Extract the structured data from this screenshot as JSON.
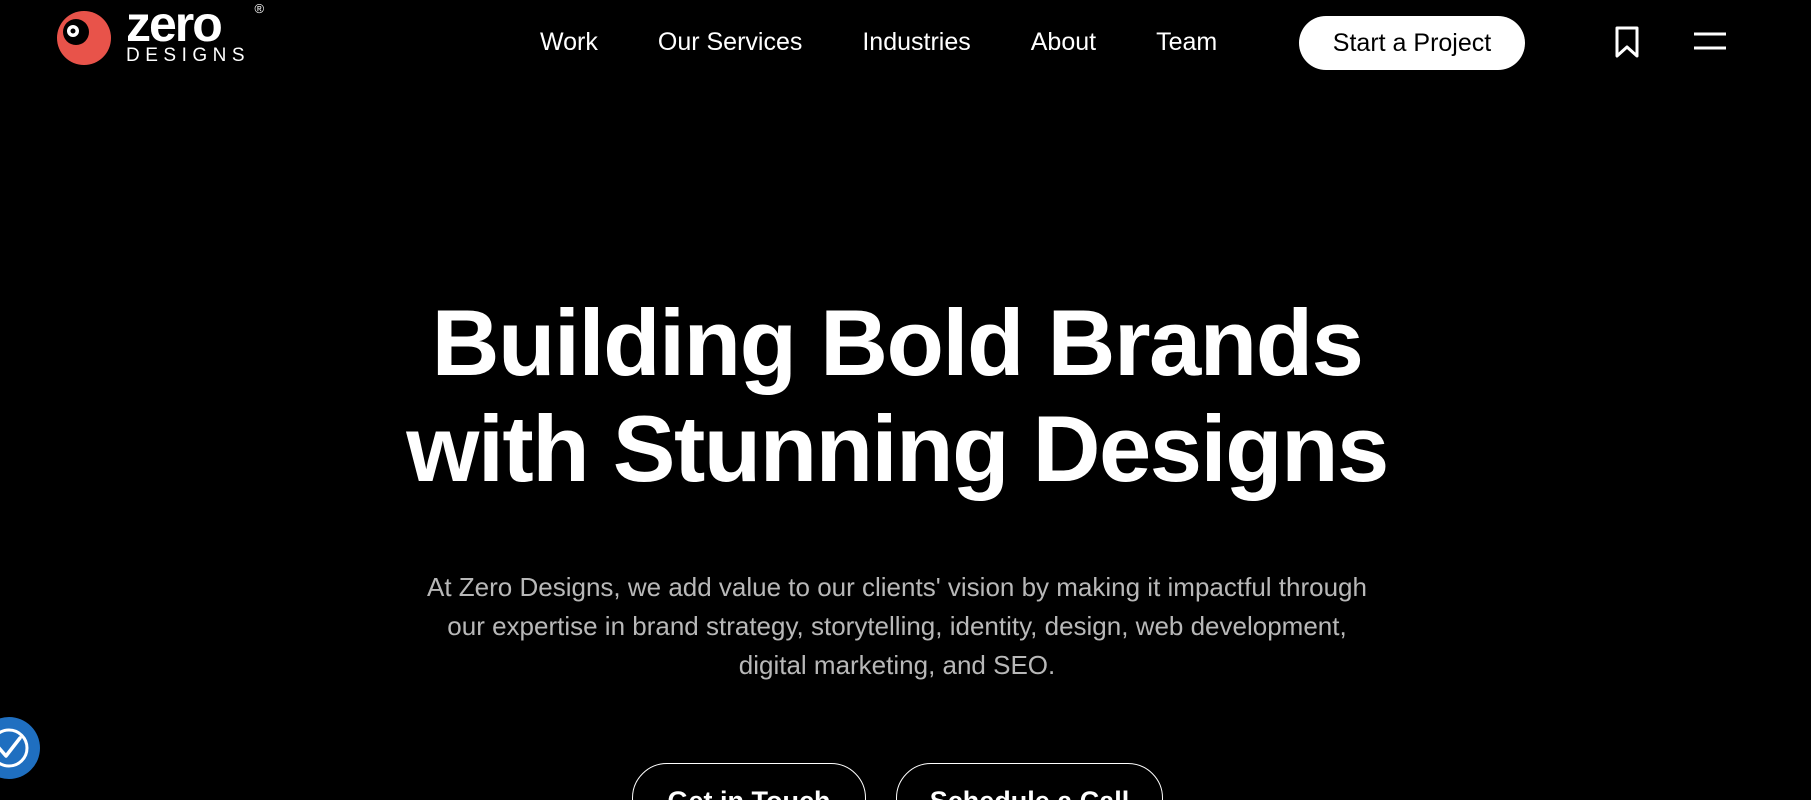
{
  "brand": {
    "name": "zero",
    "sub": "DESIGNS",
    "reg": "®",
    "accent": "#e8534a"
  },
  "nav": {
    "items": [
      {
        "label": "Work"
      },
      {
        "label": "Our Services"
      },
      {
        "label": "Industries"
      },
      {
        "label": "About"
      },
      {
        "label": "Team"
      }
    ],
    "cta_label": "Start a Project",
    "bookmark_icon": "bookmark-icon",
    "menu_icon": "hamburger-menu-icon"
  },
  "hero": {
    "title_line1": "Building Bold Brands",
    "title_line2": "with Stunning Designs",
    "desc_line1": "At Zero Designs, we add value to our clients' vision by making it impactful through",
    "desc_line2": "our expertise in brand strategy, storytelling, identity, design, web development,",
    "desc_line3": "digital marketing, and SEO.",
    "btn_touch": "Get in Touch",
    "btn_call": "Schedule a Call"
  },
  "accessibility": {
    "icon": "accessibility-check-icon",
    "color": "#1f6fc0"
  }
}
